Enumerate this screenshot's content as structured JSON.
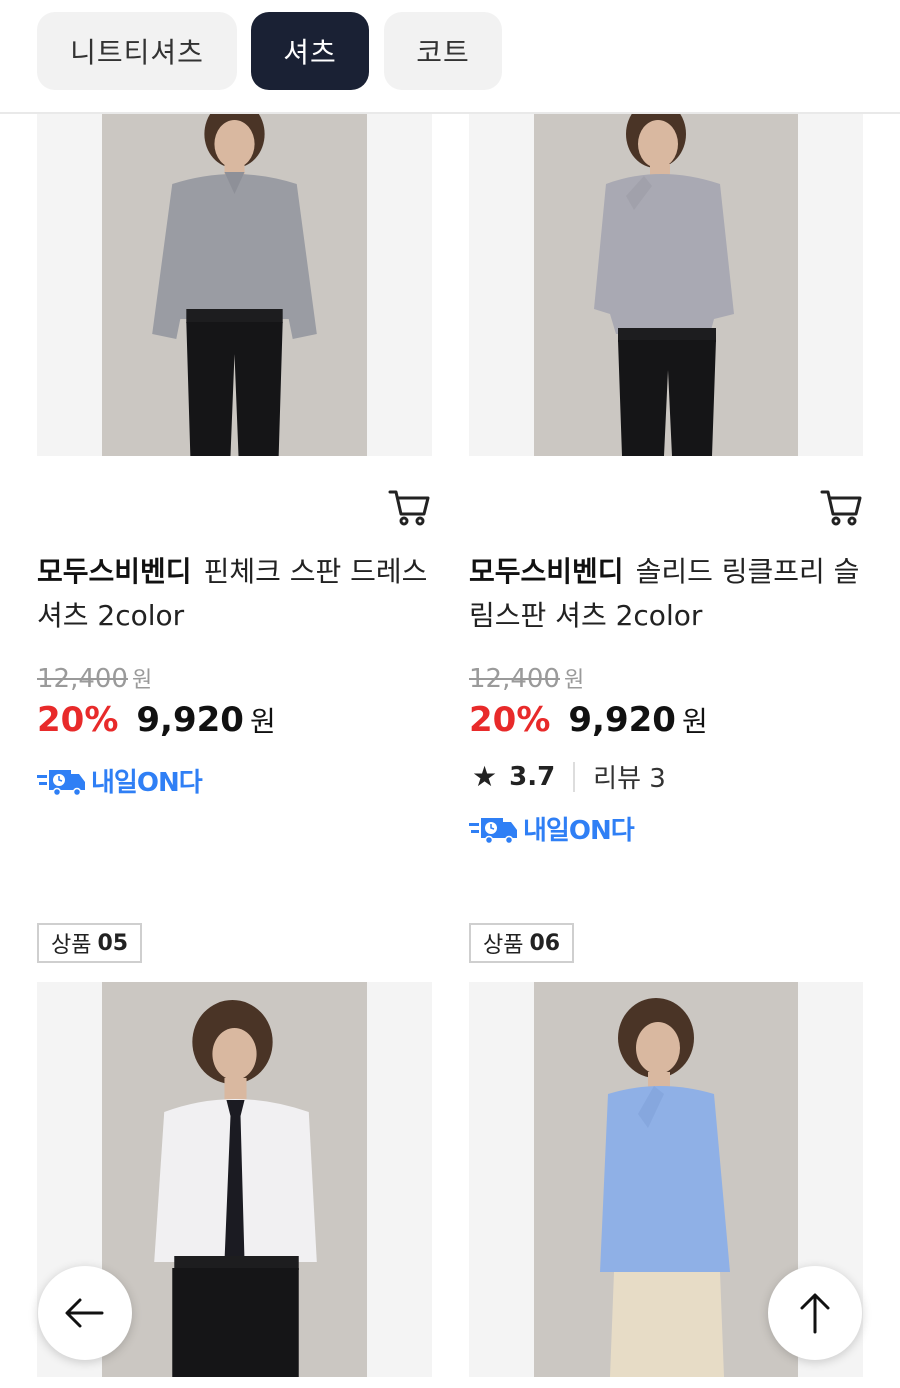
{
  "tabs": [
    {
      "label": "니트티셔츠",
      "active": false
    },
    {
      "label": "셔츠",
      "active": true
    },
    {
      "label": "코트",
      "active": false
    }
  ],
  "products": [
    {
      "brand": "모두스비벤디",
      "name": "핀체크 스판 드레스 셔츠 2color",
      "original_price": "12,400",
      "price_unit": "원",
      "discount": "20%",
      "sale_price": "9,920",
      "delivery": "내일ON다",
      "shirt_color": "#9a9ca3",
      "cart_icon": "cart-icon"
    },
    {
      "brand": "모두스비벤디",
      "name": "솔리드 링클프리 슬림스판 셔츠 2color",
      "original_price": "12,400",
      "price_unit": "원",
      "discount": "20%",
      "sale_price": "9,920",
      "rating": "3.7",
      "review_text": "리뷰 3",
      "delivery": "내일ON다",
      "shirt_color": "#a9a9b3",
      "cart_icon": "cart-icon"
    },
    {
      "badge_label": "상품",
      "badge_number": "05",
      "shirt_color": "#f1f0f2"
    },
    {
      "badge_label": "상품",
      "badge_number": "06",
      "shirt_color": "#8fb0e6"
    }
  ],
  "icons": {
    "back": "arrow-left-icon",
    "top": "arrow-up-icon",
    "star": "star-icon",
    "delivery": "delivery-truck-icon"
  },
  "colors": {
    "active_tab": "#1a2134",
    "discount": "#e82a2a",
    "delivery": "#2f7ff5"
  }
}
